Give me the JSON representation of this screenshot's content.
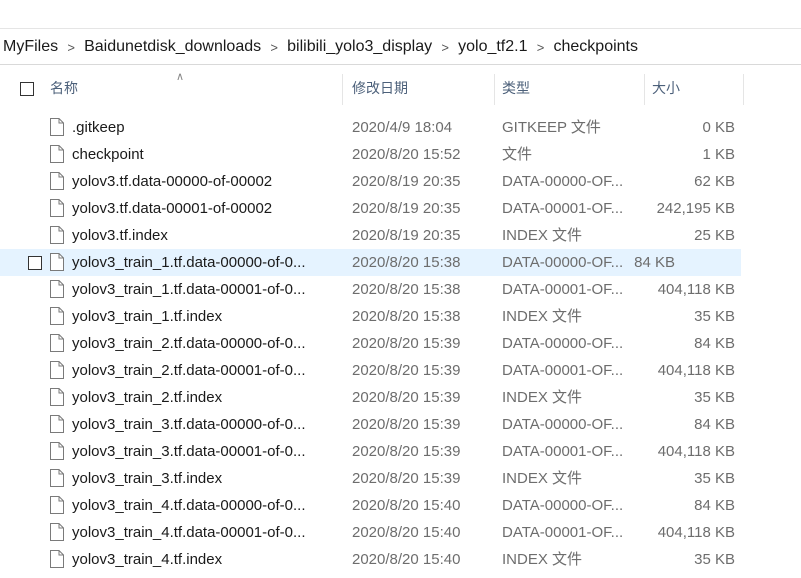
{
  "breadcrumb": {
    "items": [
      "MyFiles",
      "Baidunetdisk_downloads",
      "bilibili_yolo3_display",
      "yolo_tf2.1",
      "checkpoints"
    ],
    "separator": ">"
  },
  "columns": {
    "name": "名称",
    "date": "修改日期",
    "type": "类型",
    "size": "大小"
  },
  "files": [
    {
      "name": ".gitkeep",
      "date": "2020/4/9 18:04",
      "type": "GITKEEP 文件",
      "size": "0 KB",
      "selected": false
    },
    {
      "name": "checkpoint",
      "date": "2020/8/20 15:52",
      "type": "文件",
      "size": "1 KB",
      "selected": false
    },
    {
      "name": "yolov3.tf.data-00000-of-00002",
      "date": "2020/8/19 20:35",
      "type": "DATA-00000-OF...",
      "size": "62 KB",
      "selected": false
    },
    {
      "name": "yolov3.tf.data-00001-of-00002",
      "date": "2020/8/19 20:35",
      "type": "DATA-00001-OF...",
      "size": "242,195 KB",
      "selected": false
    },
    {
      "name": "yolov3.tf.index",
      "date": "2020/8/19 20:35",
      "type": "INDEX 文件",
      "size": "25 KB",
      "selected": false
    },
    {
      "name": "yolov3_train_1.tf.data-00000-of-0...",
      "date": "2020/8/20 15:38",
      "type": "DATA-00000-OF...",
      "size": "84 KB",
      "selected": true
    },
    {
      "name": "yolov3_train_1.tf.data-00001-of-0...",
      "date": "2020/8/20 15:38",
      "type": "DATA-00001-OF...",
      "size": "404,118 KB",
      "selected": false
    },
    {
      "name": "yolov3_train_1.tf.index",
      "date": "2020/8/20 15:38",
      "type": "INDEX 文件",
      "size": "35 KB",
      "selected": false
    },
    {
      "name": "yolov3_train_2.tf.data-00000-of-0...",
      "date": "2020/8/20 15:39",
      "type": "DATA-00000-OF...",
      "size": "84 KB",
      "selected": false
    },
    {
      "name": "yolov3_train_2.tf.data-00001-of-0...",
      "date": "2020/8/20 15:39",
      "type": "DATA-00001-OF...",
      "size": "404,118 KB",
      "selected": false
    },
    {
      "name": "yolov3_train_2.tf.index",
      "date": "2020/8/20 15:39",
      "type": "INDEX 文件",
      "size": "35 KB",
      "selected": false
    },
    {
      "name": "yolov3_train_3.tf.data-00000-of-0...",
      "date": "2020/8/20 15:39",
      "type": "DATA-00000-OF...",
      "size": "84 KB",
      "selected": false
    },
    {
      "name": "yolov3_train_3.tf.data-00001-of-0...",
      "date": "2020/8/20 15:39",
      "type": "DATA-00001-OF...",
      "size": "404,118 KB",
      "selected": false
    },
    {
      "name": "yolov3_train_3.tf.index",
      "date": "2020/8/20 15:39",
      "type": "INDEX 文件",
      "size": "35 KB",
      "selected": false
    },
    {
      "name": "yolov3_train_4.tf.data-00000-of-0...",
      "date": "2020/8/20 15:40",
      "type": "DATA-00000-OF...",
      "size": "84 KB",
      "selected": false
    },
    {
      "name": "yolov3_train_4.tf.data-00001-of-0...",
      "date": "2020/8/20 15:40",
      "type": "DATA-00001-OF...",
      "size": "404,118 KB",
      "selected": false
    },
    {
      "name": "yolov3_train_4.tf.index",
      "date": "2020/8/20 15:40",
      "type": "INDEX 文件",
      "size": "35 KB",
      "selected": false
    }
  ],
  "colors": {
    "selection": "#e5f3ff",
    "header_text": "#4c607a",
    "secondary_text": "#6d6d6d"
  },
  "icons": {
    "file": "file-icon",
    "sort": "sort-ascending-icon",
    "separator": "chevron-right-icon"
  }
}
